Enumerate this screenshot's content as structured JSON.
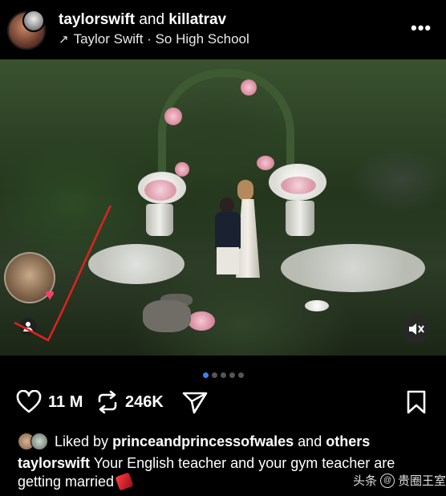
{
  "header": {
    "user1": "taylorswift",
    "and_text": "and",
    "user2": "killatrav",
    "music_arrow": "↗",
    "music_text": "Taylor Swift · So High School",
    "more": "•••"
  },
  "post": {
    "carousel_total": 5,
    "carousel_active": 1
  },
  "actions": {
    "likes": "11 M",
    "reposts": "246K"
  },
  "liked_by": {
    "prefix": "Liked by",
    "user": "princeandprincessofwales",
    "and": "and",
    "others": "others"
  },
  "caption": {
    "user": "taylorswift",
    "text": "Your English teacher and your gym teacher are getting married"
  },
  "watermark": {
    "left": "头条",
    "logo": "@",
    "right": "贵圈王室"
  },
  "colors": {
    "accent": "#3b82f6",
    "heart": "#ff3b6b",
    "annotation": "#e0221e"
  }
}
